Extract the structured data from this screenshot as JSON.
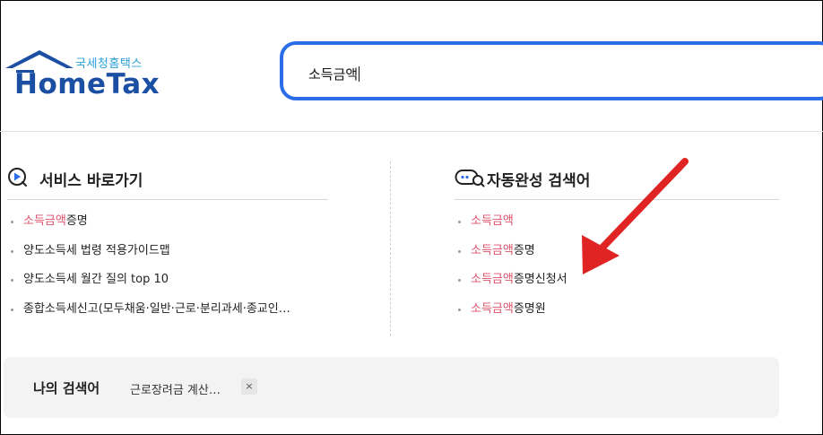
{
  "logo": {
    "korean_name": "국세청홈택스",
    "brand": "HomeTax"
  },
  "search": {
    "value": "소득금액"
  },
  "service_shortcuts": {
    "title": "서비스 바로가기",
    "items": [
      {
        "highlight": "소득금액",
        "rest": "증명"
      },
      {
        "highlight": "",
        "rest": "양도소득세 법령 적용가이드맵"
      },
      {
        "highlight": "",
        "rest": "양도소득세 월간 질의 top 10"
      },
      {
        "highlight": "",
        "rest": "종합소득세신고(모두채움·일반·근로·분리과세·종교인…"
      }
    ]
  },
  "autocomplete": {
    "title": "자동완성 검색어",
    "items": [
      {
        "highlight": "소득금액",
        "rest": ""
      },
      {
        "highlight": "소득금액",
        "rest": "증명"
      },
      {
        "highlight": "소득금액",
        "rest": "증명신청서"
      },
      {
        "highlight": "소득금액",
        "rest": "증명원"
      }
    ]
  },
  "recent_searches": {
    "title": "나의 검색어",
    "items": [
      {
        "label": "근로장려금 계산…",
        "remove": "×"
      }
    ]
  },
  "colors": {
    "accent": "#2b6de8",
    "highlight": "#e0526a",
    "arrow": "#e02424",
    "brand_blue": "#1b4fa3",
    "brand_cyan": "#2aa0d8"
  },
  "icons": {
    "logo": "house-roof-icon",
    "shortcuts": "play-circle-icon",
    "autocomplete": "chat-search-icon"
  }
}
